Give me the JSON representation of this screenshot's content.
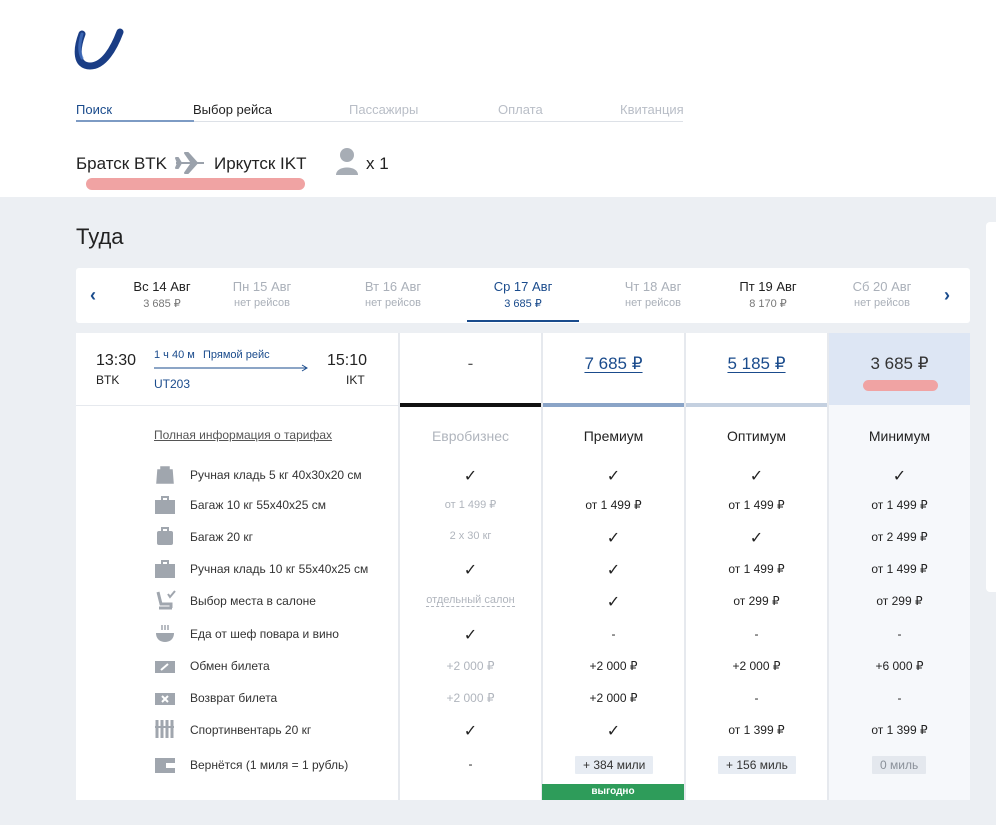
{
  "steps": [
    "Поиск",
    "Выбор рейса",
    "Пассажиры",
    "Оплата",
    "Квитанция"
  ],
  "route": {
    "from": "Братск BTK",
    "to": "Иркутск IKT",
    "pax": "x 1"
  },
  "page_title": "Туда",
  "dates": [
    {
      "day": "Вс 14 Авг",
      "price": "3 685 ₽"
    },
    {
      "day": "Пн 15 Авг",
      "price": "нет рейсов"
    },
    {
      "day": "Вт 16 Авг",
      "price": "нет рейсов"
    },
    {
      "day": "Ср 17 Авг",
      "price": "3 685 ₽"
    },
    {
      "day": "Чт 18 Авг",
      "price": "нет рейсов"
    },
    {
      "day": "Пт 19 Авг",
      "price": "8 170 ₽"
    },
    {
      "day": "Сб 20 Авг",
      "price": "нет рейсов"
    }
  ],
  "flight": {
    "dep_time": "13:30",
    "dep_code": "BTK",
    "arr_time": "15:10",
    "arr_code": "IKT",
    "duration": "1 ч 40 м",
    "type": "Прямой рейс",
    "number": "UT203"
  },
  "fares": [
    {
      "name": "Евробизнес",
      "price": "-"
    },
    {
      "name": "Премиум",
      "price": "7 685 ₽"
    },
    {
      "name": "Оптимум",
      "price": "5 185 ₽"
    },
    {
      "name": "Минимум",
      "price": "3 685 ₽"
    }
  ],
  "tariff_link": "Полная информация о тарифах",
  "rows": [
    {
      "icon": "bag-icon",
      "label": "Ручная кладь 5 кг 40x30x20 см",
      "values": [
        "✓",
        "✓",
        "✓",
        "✓"
      ]
    },
    {
      "icon": "suitcase-icon",
      "label": "Багаж 10 кг 55x40x25 см",
      "values": [
        "от 1 499 ₽",
        "от 1 499 ₽",
        "от 1 499 ₽",
        "от 1 499 ₽"
      ]
    },
    {
      "icon": "luggage-icon",
      "label": "Багаж 20 кг",
      "values": [
        "2 х 30 кг",
        "✓",
        "✓",
        "от 2 499 ₽"
      ]
    },
    {
      "icon": "suitcase-icon",
      "label": "Ручная кладь 10 кг 55x40x25 см",
      "values": [
        "✓",
        "✓",
        "от 1 499 ₽",
        "от 1 499 ₽"
      ]
    },
    {
      "icon": "seat-icon",
      "label": "Выбор места в салоне",
      "values": [
        "отдельный салон",
        "✓",
        "от 299 ₽",
        "от 299 ₽"
      ]
    },
    {
      "icon": "food-icon",
      "label": "Еда от шеф повара и вино",
      "values": [
        "✓",
        "-",
        "-",
        "-"
      ]
    },
    {
      "icon": "exchange-icon",
      "label": "Обмен билета",
      "values": [
        "+2 000 ₽",
        "+2 000 ₽",
        "+2 000 ₽",
        "+6 000 ₽"
      ]
    },
    {
      "icon": "refund-icon",
      "label": "Возврат билета",
      "values": [
        "+2 000 ₽",
        "+2 000 ₽",
        "-",
        "-"
      ]
    },
    {
      "icon": "sport-icon",
      "label": "Спортинвентарь 20 кг",
      "values": [
        "✓",
        "✓",
        "от 1 399 ₽",
        "от 1 399 ₽"
      ]
    },
    {
      "icon": "wallet-icon",
      "label": "Вернётся (1 миля = 1 рубль)",
      "values": [
        "-",
        "+ 384 мили",
        "+ 156 миль",
        "0 миль"
      ]
    }
  ],
  "promo": "выгодно",
  "colors": {
    "brand": "#1a4b8c",
    "highlight": "#f0a3a3",
    "selected_fare_bg": "#dde6f4",
    "green": "#2e9c5a"
  }
}
